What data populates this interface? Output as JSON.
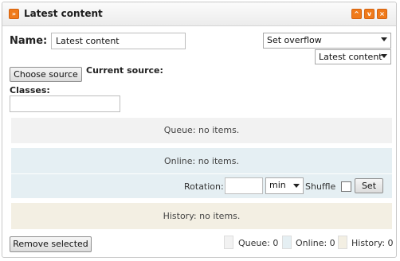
{
  "window": {
    "title": "Latest content",
    "collapse_icon": "double-chevron-down-icon",
    "buttons": [
      "chevron-up-icon",
      "chevron-down-icon",
      "close-icon"
    ]
  },
  "form": {
    "name_label": "Name:",
    "name_value": "Latest content",
    "overflow_select": "Set overflow",
    "content_select": "Latest content",
    "choose_source_label": "Choose source",
    "current_source_label": "Current source:",
    "classes_label": "Classes:",
    "classes_value": ""
  },
  "queue": {
    "text": "Queue: no items.",
    "color": "#f2f2f2"
  },
  "online": {
    "text": "Online: no items.",
    "color": "#e5eff3",
    "rotation_label": "Rotation:",
    "rotation_value": "",
    "rotation_unit": "min",
    "shuffle_label": "Shuffle",
    "set_label": "Set"
  },
  "history": {
    "text": "History: no items.",
    "color": "#f3efe3"
  },
  "footer": {
    "remove_label": "Remove selected",
    "legend": [
      {
        "label": "Queue: 0",
        "color": "#f2f2f2"
      },
      {
        "label": "Online: 0",
        "color": "#e5eff3"
      },
      {
        "label": "History: 0",
        "color": "#f3efe3"
      }
    ]
  },
  "accent_color": "#f07a1a"
}
